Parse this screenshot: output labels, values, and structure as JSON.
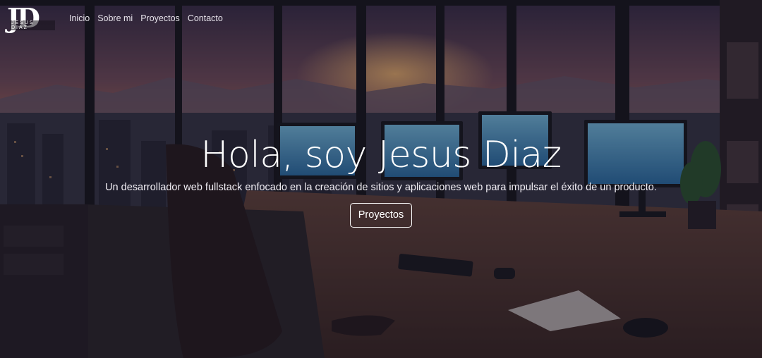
{
  "brand": {
    "logo_text": "JD",
    "logo_subtext": "JESUS DIAZ"
  },
  "nav": {
    "items": [
      {
        "label": "Inicio"
      },
      {
        "label": "Sobre mi"
      },
      {
        "label": "Proyectos"
      },
      {
        "label": "Contacto"
      }
    ]
  },
  "hero": {
    "title": "Hola, soy Jesus Diaz",
    "subtitle": "Un desarrollador web fullstack enfocado en la creación de sitios y aplicaciones web para impulsar el éxito de un producto.",
    "button_label": "Proyectos"
  },
  "colors": {
    "text": "#ffffff",
    "overlay": "#0a0810"
  }
}
